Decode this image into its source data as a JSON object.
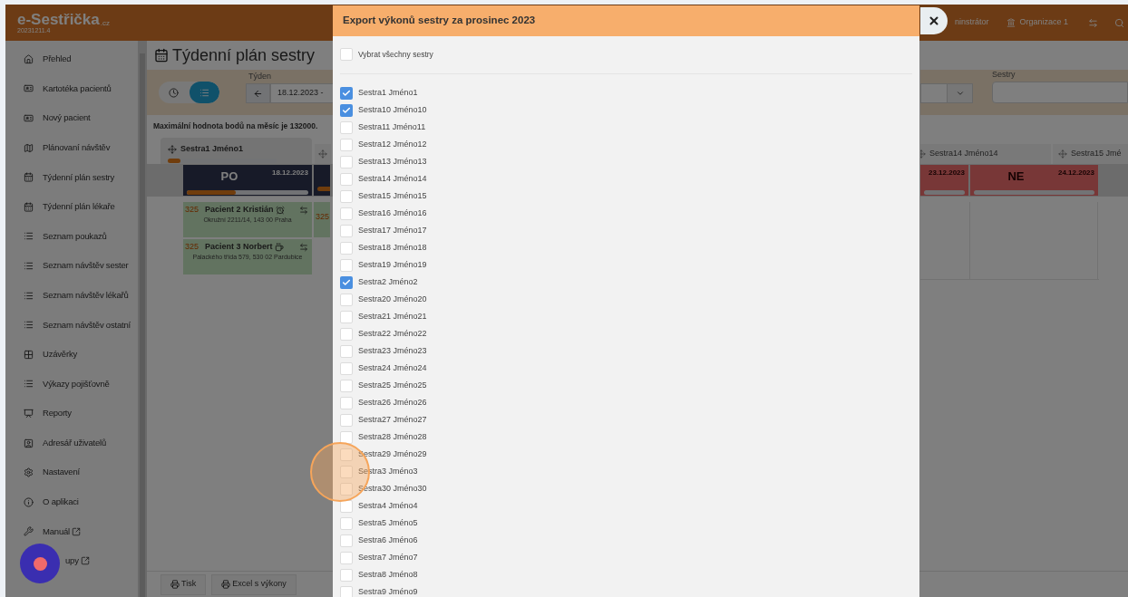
{
  "app": {
    "logo": "e-Sestřička",
    "logo_suffix": ".cz",
    "version": "20231211.4",
    "user": "ninstrátor",
    "organization": "Organizace 1"
  },
  "sidebar": {
    "items": [
      {
        "label": "Přehled",
        "external": false,
        "covered": false
      },
      {
        "label": "Kartotéka pacientů",
        "external": false,
        "covered": false
      },
      {
        "label": "Nový pacient",
        "external": false,
        "covered": false
      },
      {
        "label": "Plánovaní návštěv",
        "external": false,
        "covered": false
      },
      {
        "label": "Týdenní plán sestry",
        "external": false,
        "covered": false
      },
      {
        "label": "Týdenní plán lékaře",
        "external": false,
        "covered": false
      },
      {
        "label": "Seznam poukazů",
        "external": false,
        "covered": false
      },
      {
        "label": "Seznam návštěv sester",
        "external": false,
        "covered": false
      },
      {
        "label": "Seznam návštěv lékařů",
        "external": false,
        "covered": false
      },
      {
        "label": "Seznam návštěv ostatní",
        "external": false,
        "covered": false
      },
      {
        "label": "Uzávěrky",
        "external": false,
        "covered": false
      },
      {
        "label": "Výkazy pojišťovně",
        "external": false,
        "covered": false
      },
      {
        "label": "Reporty",
        "external": false,
        "covered": false
      },
      {
        "label": "Adresář uživatelů",
        "external": false,
        "covered": false
      },
      {
        "label": "Nastavení",
        "external": false,
        "covered": false
      },
      {
        "label": "O aplikaci",
        "external": false,
        "covered": false
      },
      {
        "label": "Manuál",
        "external": true,
        "covered": false
      },
      {
        "label": "upy",
        "external": true,
        "covered": true
      }
    ]
  },
  "page": {
    "title": "Týdenní plán sestry",
    "view_toggle": [
      {
        "kind": "clock",
        "selected": false
      },
      {
        "kind": "list",
        "selected": true
      }
    ],
    "week_label": "Týden",
    "week_value": "18.12.2023 -",
    "nurses_label": "Sestry",
    "note": "Maximální hodnota bodů na měsíc je 132000.",
    "nurse_columns": [
      {
        "name": "Sestra1 Jméno1",
        "level": 0.12
      }
    ],
    "days": [
      {
        "day": "PO",
        "date": "18.12.2023",
        "level": 0.4,
        "weekend": false
      }
    ],
    "visits": [
      {
        "points": "325",
        "patient": "Pacient 2 Kristián",
        "address": "Okružní 2211/14, 143 00 Praha"
      },
      {
        "points": "325",
        "patient": "Pacient 3 Norbert",
        "address": "Palackého třída 579, 530 02 Pardubice"
      }
    ],
    "next_column_points": "325",
    "right_nurse_columns": [
      {
        "name": "Sestra14 Jméno14"
      },
      {
        "name": "Sestra15 Jmé"
      }
    ],
    "right_days": [
      {
        "date": "23.12.2023",
        "weekend": true
      },
      {
        "day": "NE",
        "date": "24.12.2023",
        "weekend": true
      }
    ],
    "footer_buttons": [
      "Tisk",
      "Excel s výkony"
    ]
  },
  "modal": {
    "title": "Export výkonů sestry za prosinec 2023",
    "select_all": {
      "label": "Vybrat všechny sestry",
      "checked": false
    },
    "nurses": [
      {
        "name": "Sestra1 Jméno1",
        "checked": true
      },
      {
        "name": "Sestra10 Jméno10",
        "checked": true
      },
      {
        "name": "Sestra11 Jméno11",
        "checked": false
      },
      {
        "name": "Sestra12 Jméno12",
        "checked": false
      },
      {
        "name": "Sestra13 Jméno13",
        "checked": false
      },
      {
        "name": "Sestra14 Jméno14",
        "checked": false
      },
      {
        "name": "Sestra15 Jméno15",
        "checked": false
      },
      {
        "name": "Sestra16 Jméno16",
        "checked": false
      },
      {
        "name": "Sestra17 Jméno17",
        "checked": false
      },
      {
        "name": "Sestra18 Jméno18",
        "checked": false
      },
      {
        "name": "Sestra19 Jméno19",
        "checked": false
      },
      {
        "name": "Sestra2 Jméno2",
        "checked": true
      },
      {
        "name": "Sestra20 Jméno20",
        "checked": false
      },
      {
        "name": "Sestra21 Jméno21",
        "checked": false
      },
      {
        "name": "Sestra22 Jméno22",
        "checked": false
      },
      {
        "name": "Sestra23 Jméno23",
        "checked": false
      },
      {
        "name": "Sestra24 Jméno24",
        "checked": false
      },
      {
        "name": "Sestra25 Jméno25",
        "checked": false
      },
      {
        "name": "Sestra26 Jméno26",
        "checked": false
      },
      {
        "name": "Sestra27 Jméno27",
        "checked": false
      },
      {
        "name": "Sestra28 Jméno28",
        "checked": false
      },
      {
        "name": "Sestra29 Jméno29",
        "checked": false
      },
      {
        "name": "Sestra3 Jméno3",
        "checked": false
      },
      {
        "name": "Sestra30 Jméno30",
        "checked": false
      },
      {
        "name": "Sestra4 Jméno4",
        "checked": false
      },
      {
        "name": "Sestra5 Jméno5",
        "checked": false
      },
      {
        "name": "Sestra6 Jméno6",
        "checked": false
      },
      {
        "name": "Sestra7 Jméno7",
        "checked": false
      },
      {
        "name": "Sestra8 Jméno8",
        "checked": false
      },
      {
        "name": "Sestra9 Jméno9",
        "checked": false
      }
    ]
  }
}
